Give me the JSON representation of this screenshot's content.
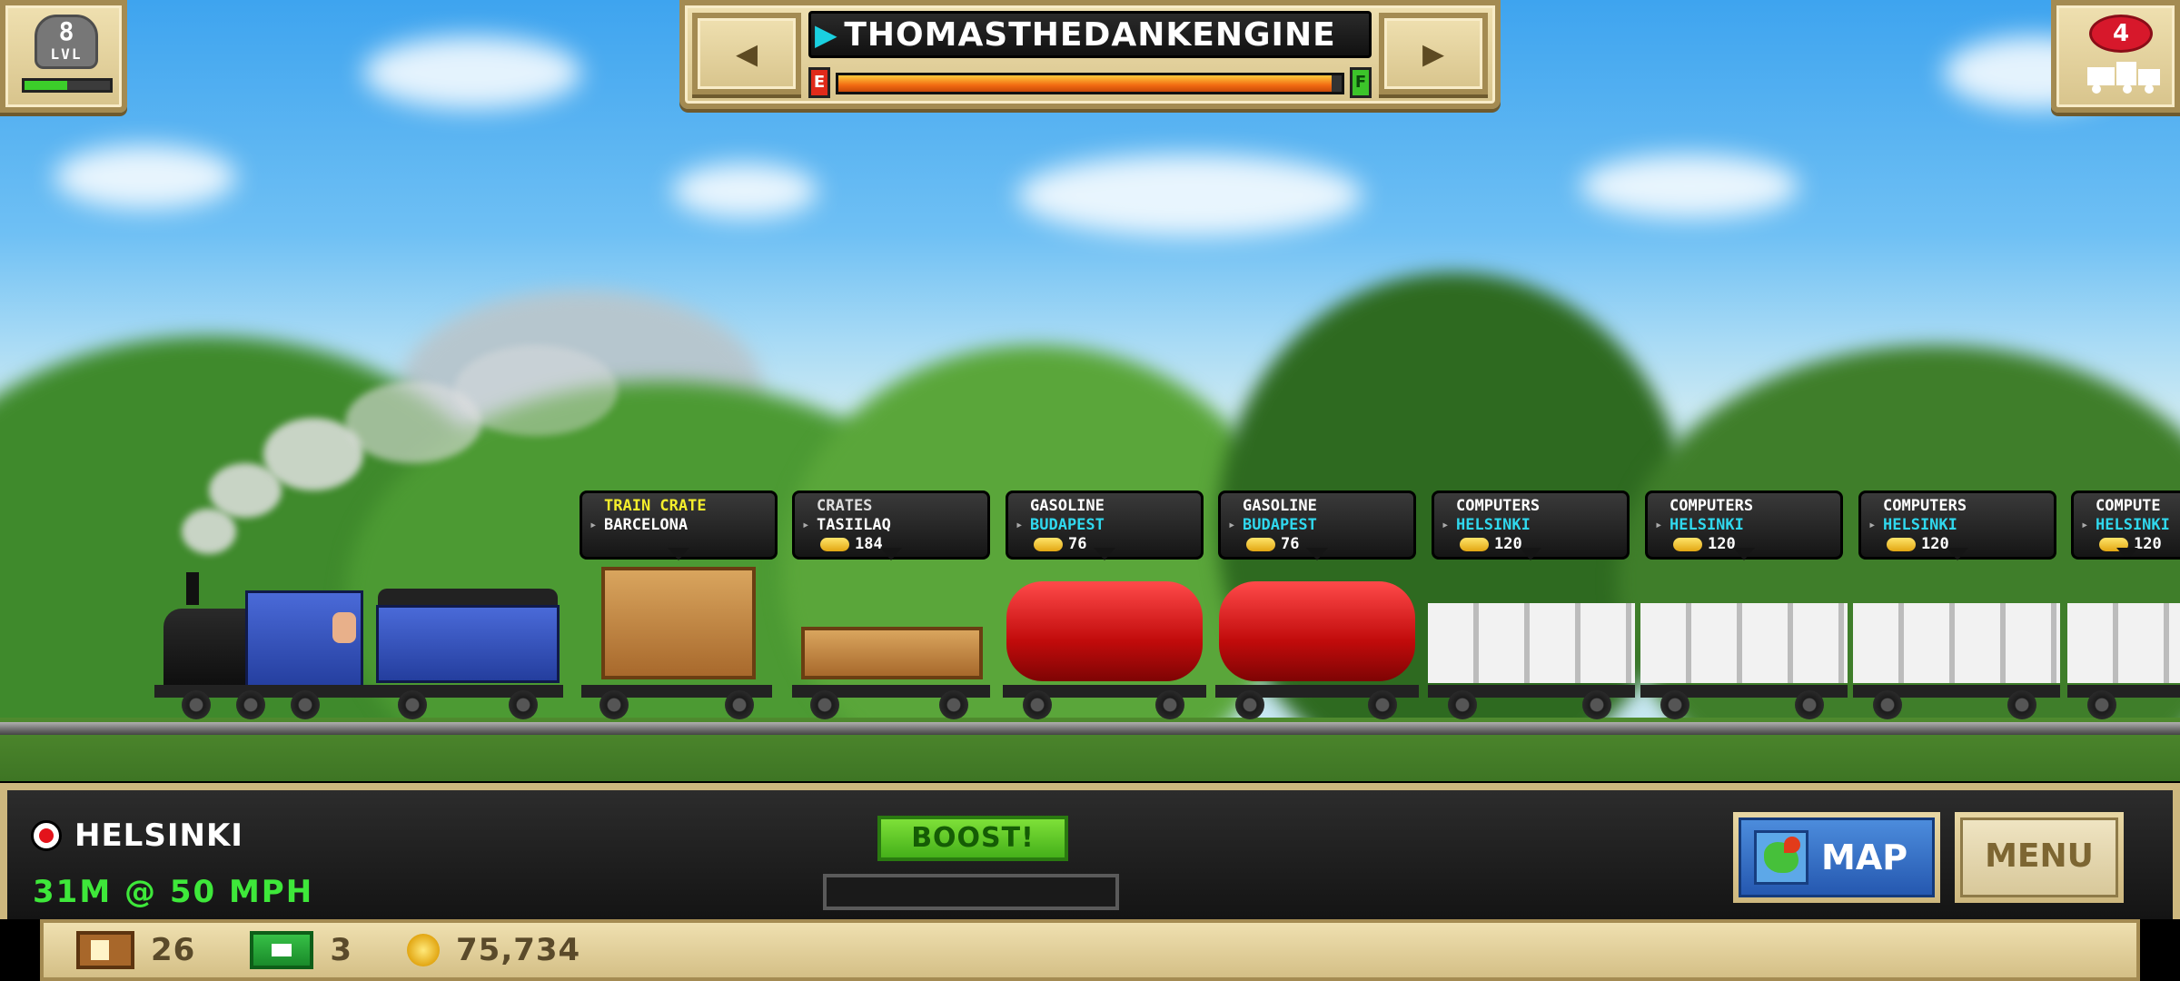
{
  "level": {
    "number": "8",
    "label": "LVL",
    "xp_progress": 0.5
  },
  "train": {
    "name": "THOMASTHEDANKENGINE",
    "fuel_empty_label": "E",
    "fuel_full_label": "F",
    "fuel_level": 0.98
  },
  "cars_badge": {
    "count": "4"
  },
  "cargo": [
    {
      "cargo": "TRAIN CRATE",
      "cargo_color": "yellow",
      "destination": "BARCELONA",
      "dest_color": "white",
      "pay": ""
    },
    {
      "cargo": "CRATES",
      "cargo_color": "muted",
      "destination": "TASIILAQ",
      "dest_color": "white",
      "pay": "184"
    },
    {
      "cargo": "GASOLINE",
      "cargo_color": "white",
      "destination": "BUDAPEST",
      "dest_color": "cyan",
      "pay": "76"
    },
    {
      "cargo": "GASOLINE",
      "cargo_color": "white",
      "destination": "BUDAPEST",
      "dest_color": "cyan",
      "pay": "76"
    },
    {
      "cargo": "COMPUTERS",
      "cargo_color": "white",
      "destination": "HELSINKI",
      "dest_color": "cyan",
      "pay": "120"
    },
    {
      "cargo": "COMPUTERS",
      "cargo_color": "white",
      "destination": "HELSINKI",
      "dest_color": "cyan",
      "pay": "120"
    },
    {
      "cargo": "COMPUTERS",
      "cargo_color": "white",
      "destination": "HELSINKI",
      "dest_color": "cyan",
      "pay": "120"
    },
    {
      "cargo": "COMPUTE",
      "cargo_color": "white",
      "destination": "HELSINKI",
      "dest_color": "cyan",
      "pay": "120"
    }
  ],
  "hud": {
    "station": "HELSINKI",
    "speed": "31M @ 50 MPH",
    "boost_label": "BOOST!",
    "boost_progress": 0.0,
    "map_label": "MAP",
    "menu_label": "MENU"
  },
  "resources": {
    "crates": "26",
    "cash": "3",
    "coins": "75,734"
  },
  "colors": {
    "accent_green": "#3ee83a",
    "accent_cyan": "#30d8ee",
    "accent_yellow": "#f4ee2c",
    "wood": "#d8c48c"
  }
}
